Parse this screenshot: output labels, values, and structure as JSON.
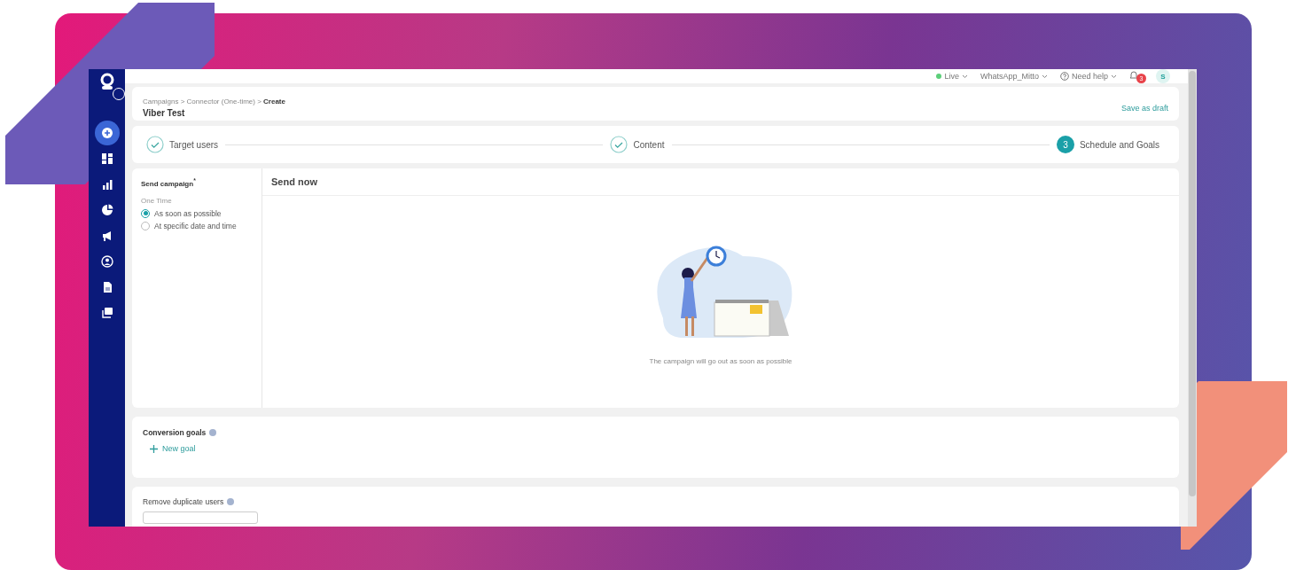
{
  "topbar": {
    "environment": {
      "label": "Live",
      "color": "#5ccf7a"
    },
    "account": "WhatsApp_Mitto",
    "help": "Need help",
    "notifications": "3",
    "avatar": "S"
  },
  "sidebar": {
    "items": [
      {
        "kind": "create",
        "selected": true
      },
      {
        "kind": "dashboard",
        "selected": false
      },
      {
        "kind": "bars",
        "selected": false
      },
      {
        "kind": "pie",
        "selected": false
      },
      {
        "kind": "megaphone",
        "selected": false
      },
      {
        "kind": "person",
        "selected": false
      },
      {
        "kind": "document",
        "selected": false
      },
      {
        "kind": "gallery",
        "selected": false
      }
    ]
  },
  "header": {
    "breadcrumb": "Campaigns > Connector (One-time) > **Create**",
    "title": "Viber Test",
    "save_link": "Save as draft"
  },
  "steps": [
    {
      "label": "Target users",
      "completed": true
    },
    {
      "label": "Content",
      "completed": true
    },
    {
      "label": "Schedule and Goals",
      "completed": false,
      "number": "3"
    }
  ],
  "send_campaign": {
    "label": "Send campaign$^{*}$",
    "group": "One Time",
    "options": [
      {
        "label": "As soon as possible",
        "selected": true
      },
      {
        "label": "At specific date and time",
        "selected": false
      }
    ],
    "panel_title": "Send now",
    "caption": "The campaign will go out as soon as possible"
  },
  "conversion_goals": {
    "title": "Conversion goals",
    "action": "New goal"
  },
  "remove_duplicates": {
    "title": "Remove duplicate users"
  }
}
